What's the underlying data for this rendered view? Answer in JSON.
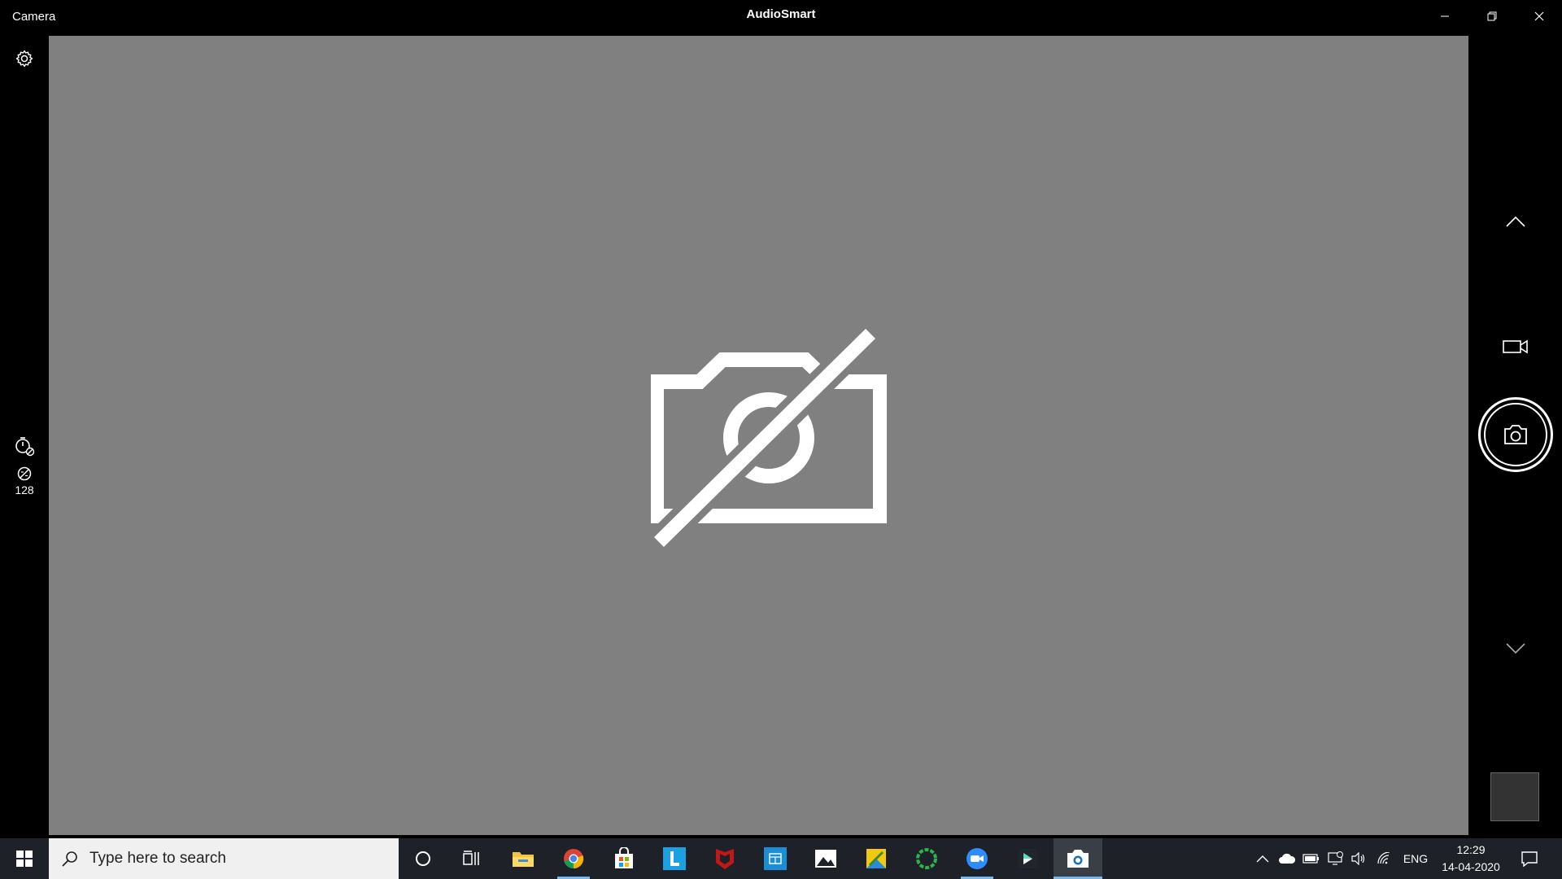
{
  "app": {
    "name": "Camera",
    "window_title": "AudioSmart"
  },
  "window_controls": {
    "minimize_icon": "minimize-icon",
    "restore_icon": "restore-icon",
    "close_icon": "close-icon"
  },
  "left_rail": {
    "settings_icon": "gear-icon",
    "timer_icon": "timer-off-icon",
    "brightness_icon": "brightness-icon",
    "brightness_value": "128"
  },
  "preview": {
    "status_icon": "camera-off-icon"
  },
  "right_rail": {
    "up_icon": "chevron-up-icon",
    "mode_video_icon": "video-camera-icon",
    "shutter_icon": "camera-icon",
    "down_icon": "chevron-down-icon",
    "thumbnail_icon": "photo-thumbnail"
  },
  "taskbar": {
    "search_placeholder": "Type here to search",
    "pinned_apps": [
      "cortana-circle-icon",
      "task-view-icon",
      "file-explorer-icon",
      "chrome-icon",
      "microsoft-store-icon",
      "l-app-icon",
      "mcafee-icon",
      "blue-app-icon",
      "photos-icon",
      "sticky-app-icon",
      "green-ring-app-icon",
      "zoom-icon",
      "filmora-icon",
      "camera-app-icon"
    ],
    "tray": {
      "language": "ENG",
      "time": "12:29",
      "date": "14-04-2020"
    }
  },
  "colors": {
    "preview_bg": "#808080",
    "taskbar_bg": "#1e2228",
    "accent": "#76b9ed"
  }
}
